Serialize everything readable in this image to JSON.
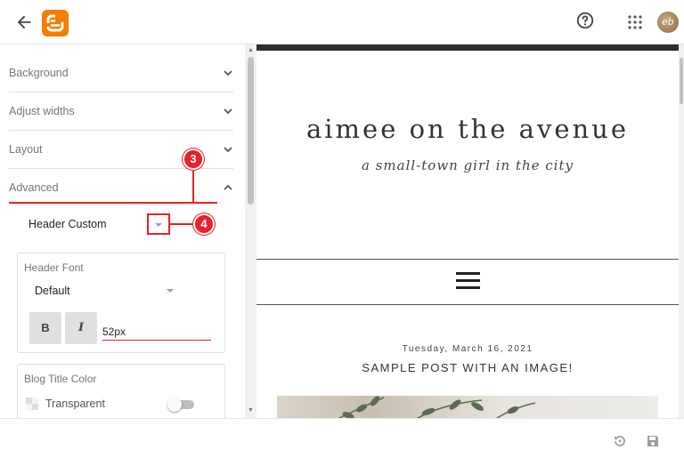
{
  "sidebar": {
    "sections": [
      {
        "label": "Background"
      },
      {
        "label": "Adjust widths"
      },
      {
        "label": "Layout"
      },
      {
        "label": "Advanced"
      }
    ],
    "header_custom": {
      "label": "Header Custom"
    },
    "header_font": {
      "title": "Header Font",
      "family_value": "Default",
      "bold_label": "B",
      "italic_label": "I",
      "size_value": "52px"
    },
    "blog_title_color": {
      "title": "Blog Title Color",
      "transparent_label": "Transparent",
      "transparent_on": false
    }
  },
  "annotations": {
    "step3": "3",
    "step4": "4",
    "color": "#e8222a"
  },
  "preview": {
    "blog_title": "aimee on the avenue",
    "blog_tagline": "a small-town girl in the city",
    "post_date": "Tuesday, March 16, 2021",
    "post_title": "SAMPLE POST WITH AN IMAGE!"
  },
  "header": {
    "avatar_initials": "eb"
  },
  "colors": {
    "brand": "#f57d00",
    "accent_red": "#e8222a",
    "preview_bar": "#2d2d2d"
  },
  "icons": [
    "back-arrow-icon",
    "blogger-logo-icon",
    "help-icon",
    "apps-grid-icon",
    "chevron-down-icon",
    "chevron-up-icon",
    "transparent-pattern-icon",
    "revert-icon",
    "save-icon"
  ]
}
